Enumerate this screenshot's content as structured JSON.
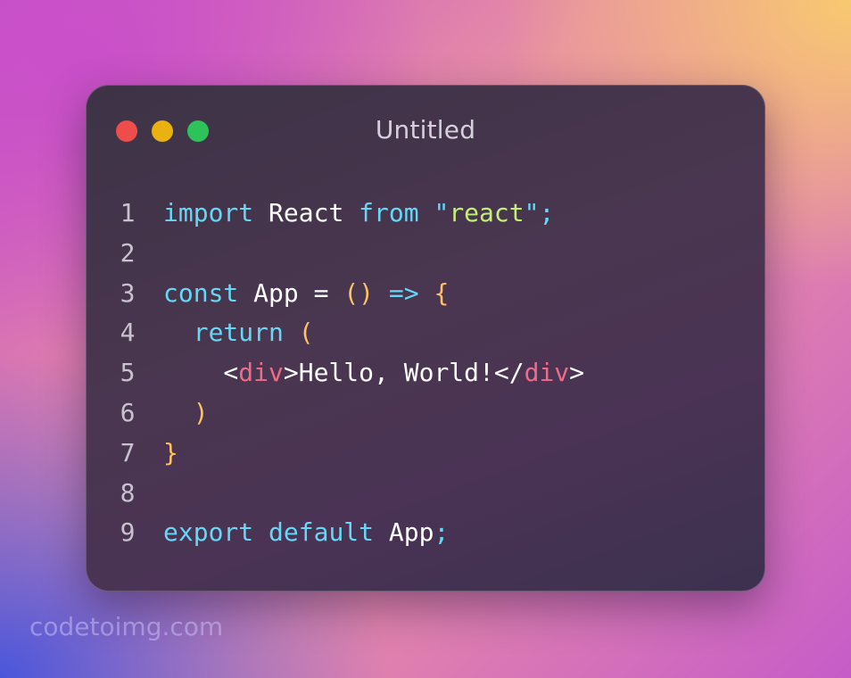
{
  "window": {
    "title": "Untitled",
    "controls": [
      {
        "name": "close",
        "color": "#ef4c4c"
      },
      {
        "name": "minimize",
        "color": "#e9b210"
      },
      {
        "name": "zoom",
        "color": "#2ec25a"
      }
    ]
  },
  "editor": {
    "lines": [
      {
        "number": "1",
        "tokens": [
          {
            "t": "import",
            "k": "keyword"
          },
          {
            "t": " ",
            "k": "punct"
          },
          {
            "t": "React",
            "k": "ident"
          },
          {
            "t": " ",
            "k": "punct"
          },
          {
            "t": "from",
            "k": "keyword"
          },
          {
            "t": " ",
            "k": "punct"
          },
          {
            "t": "\"",
            "k": "quote"
          },
          {
            "t": "react",
            "k": "string"
          },
          {
            "t": "\"",
            "k": "quote"
          },
          {
            "t": ";",
            "k": "semi"
          }
        ]
      },
      {
        "number": "2",
        "tokens": []
      },
      {
        "number": "3",
        "tokens": [
          {
            "t": "const",
            "k": "keyword"
          },
          {
            "t": " ",
            "k": "punct"
          },
          {
            "t": "App",
            "k": "ident"
          },
          {
            "t": " = ",
            "k": "punct"
          },
          {
            "t": "()",
            "k": "paren"
          },
          {
            "t": " ",
            "k": "punct"
          },
          {
            "t": "=>",
            "k": "arrow"
          },
          {
            "t": " ",
            "k": "punct"
          },
          {
            "t": "{",
            "k": "paren"
          }
        ]
      },
      {
        "number": "4",
        "tokens": [
          {
            "t": "  ",
            "k": "punct"
          },
          {
            "t": "return",
            "k": "keyword"
          },
          {
            "t": " ",
            "k": "punct"
          },
          {
            "t": "(",
            "k": "paren"
          }
        ]
      },
      {
        "number": "5",
        "tokens": [
          {
            "t": "    <",
            "k": "punct"
          },
          {
            "t": "div",
            "k": "tag"
          },
          {
            "t": ">Hello, World!</",
            "k": "punct"
          },
          {
            "t": "div",
            "k": "tag"
          },
          {
            "t": ">",
            "k": "punct"
          }
        ]
      },
      {
        "number": "6",
        "tokens": [
          {
            "t": "  ",
            "k": "punct"
          },
          {
            "t": ")",
            "k": "paren"
          }
        ]
      },
      {
        "number": "7",
        "tokens": [
          {
            "t": "}",
            "k": "paren"
          }
        ]
      },
      {
        "number": "8",
        "tokens": []
      },
      {
        "number": "9",
        "tokens": [
          {
            "t": "export",
            "k": "keyword"
          },
          {
            "t": " ",
            "k": "punct"
          },
          {
            "t": "default",
            "k": "keyword"
          },
          {
            "t": " ",
            "k": "punct"
          },
          {
            "t": "App",
            "k": "ident"
          },
          {
            "t": ";",
            "k": "semi"
          }
        ]
      }
    ]
  },
  "watermark": {
    "text": "codetoimg.com"
  }
}
